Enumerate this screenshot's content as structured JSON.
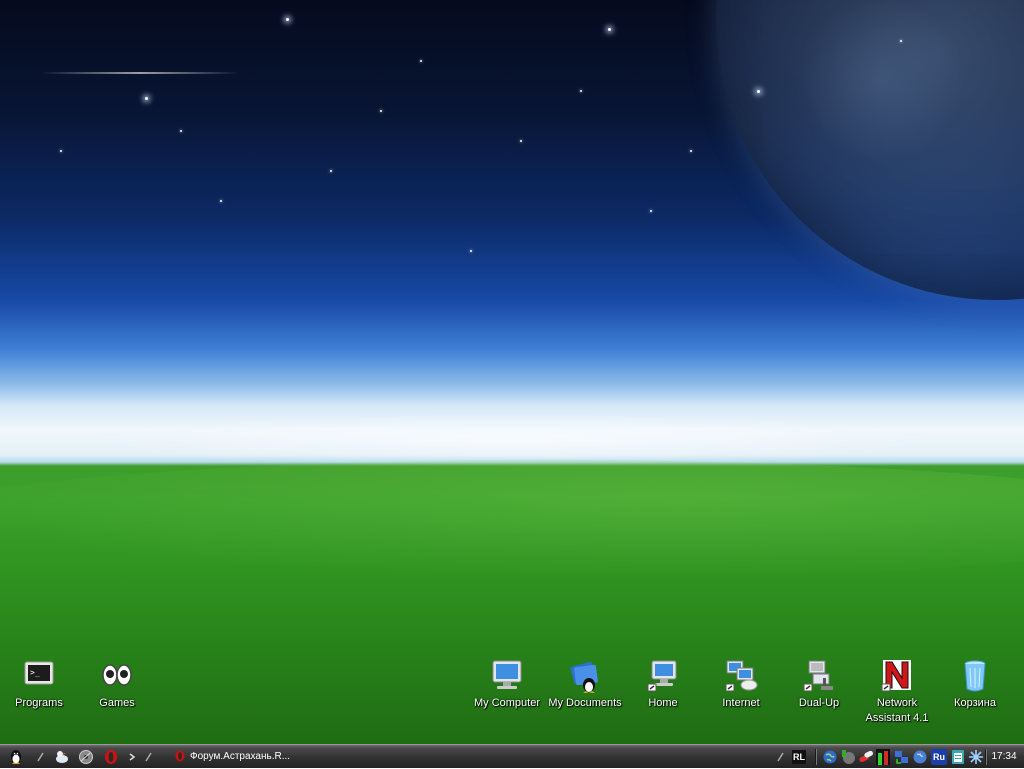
{
  "desktop": {
    "logo_text": "",
    "icons": [
      {
        "label": "Programs",
        "icon": "terminal-icon"
      },
      {
        "label": "Games",
        "icon": "eyes-icon"
      },
      {
        "label": "My Computer",
        "icon": "monitor-icon"
      },
      {
        "label": "My Documents",
        "icon": "documents-penguin-icon"
      },
      {
        "label": "Home",
        "icon": "home-computer-icon"
      },
      {
        "label": "Internet",
        "icon": "network-globe-icon"
      },
      {
        "label": "Dual-Up",
        "icon": "dialup-computer-icon"
      },
      {
        "label": "Network\nAssistant 4.1",
        "icon": "network-assistant-n-icon"
      },
      {
        "label": "Корзина",
        "icon": "trash-bin-icon"
      }
    ]
  },
  "taskbar": {
    "launchers": [
      "start-penguin-icon",
      "launcher-arrow-icon",
      "mail-bird-icon",
      "disk-icon",
      "opera-icon",
      "more-arrow-icon"
    ],
    "tasks": [
      {
        "label": "Форум.Астрахань.R...",
        "icon": "opera-icon"
      }
    ],
    "tray": {
      "keyboard_layout": "RL",
      "language": "Ru",
      "clock": "17:34",
      "icons": [
        "globe-icon",
        "network-icon",
        "pills-icon",
        "cpu-meter-icon",
        "network-activity-icon",
        "earth-icon",
        "language-icon",
        "clipboard-icon",
        "snowflake-icon"
      ]
    }
  },
  "colors": {
    "taskbar": "#2a2a2a",
    "icon_label": "#ffffff",
    "opera_red": "#cc1111"
  }
}
